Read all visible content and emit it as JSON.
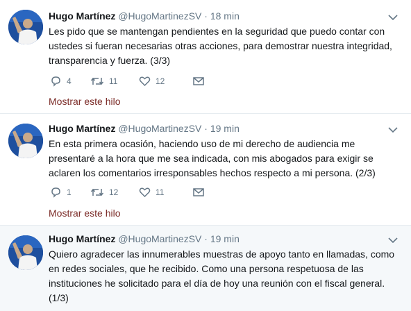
{
  "tweets": [
    {
      "name": "Hugo Martínez",
      "handle": "@HugoMartinezSV",
      "sep": "·",
      "time": "18 min",
      "text": "Les pido que se mantengan pendientes en la seguridad que puedo contar con ustedes si fueran necesarias otras acciones, para demostrar nuestra integridad, transparencia y fuerza. (3/3)",
      "replies": "4",
      "retweets": "11",
      "likes": "12",
      "thread_link": "Mostrar este hilo"
    },
    {
      "name": "Hugo Martínez",
      "handle": "@HugoMartinezSV",
      "sep": "·",
      "time": "19 min",
      "text": "En esta primera ocasión, haciendo uso de mi derecho de audiencia  me presentaré a la hora que me sea indicada, con mis abogados para exigir se aclaren los comentarios irresponsables hechos respecto a mi persona. (2/3)",
      "replies": "1",
      "retweets": "12",
      "likes": "11",
      "thread_link": "Mostrar este hilo"
    },
    {
      "name": "Hugo Martínez",
      "handle": "@HugoMartinezSV",
      "sep": "·",
      "time": "19 min",
      "text": "Quiero agradecer las innumerables muestras de apoyo tanto en llamadas, como en redes sociales, que he recibido. Como una persona respetuosa de las instituciones he solicitado para el día de hoy una reunión con el fiscal general. (1/3)"
    }
  ],
  "colors": {
    "thread_link": "#7b2b27",
    "muted": "#657786",
    "tinted_bg": "#f5f8fa"
  },
  "icons": [
    "reply-icon",
    "retweet-icon",
    "like-icon",
    "message-icon",
    "chevron-down-icon"
  ]
}
